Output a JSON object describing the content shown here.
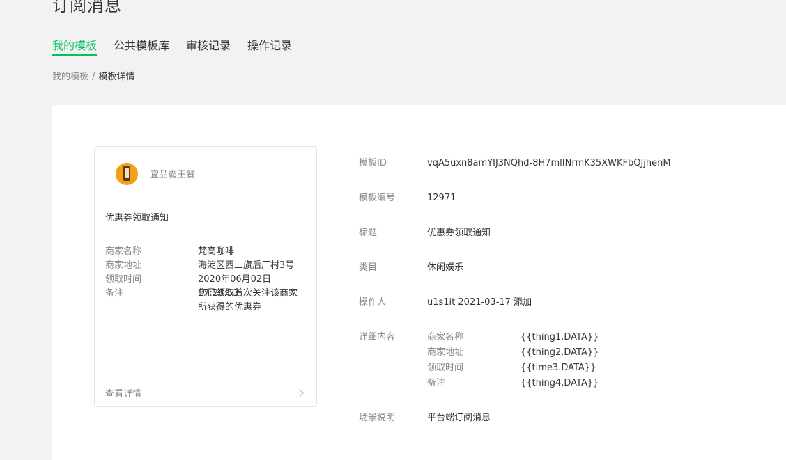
{
  "page": {
    "title": "订阅消息"
  },
  "tabs": [
    {
      "label": "我的模板",
      "active": true
    },
    {
      "label": "公共模板库",
      "active": false
    },
    {
      "label": "审核记录",
      "active": false
    },
    {
      "label": "操作记录",
      "active": false
    }
  ],
  "breadcrumb": {
    "parent": "我的模板",
    "separator": "/",
    "current": "模板详情"
  },
  "preview": {
    "avatar_icon": "phone-logo-icon",
    "shop_name": "宜品霸王餐",
    "title": "优惠券领取通知",
    "fields": [
      {
        "key": "商家名称",
        "value": "梵高咖啡"
      },
      {
        "key": "商家地址",
        "value": "海淀区西二旗后厂村3号"
      },
      {
        "key": "领取时间",
        "value": "2020年06月02日17:28:53"
      },
      {
        "key": "备注",
        "value": "您已领取首次关注该商家所获得的优惠券"
      }
    ],
    "footer_label": "查看详情",
    "footer_icon": "chevron-right-icon"
  },
  "info": {
    "template_id": {
      "label": "模板ID",
      "value": "vqA5uxn8amYIJ3NQhd-8H7mlINrmK35XWKFbQJjhenM"
    },
    "template_no": {
      "label": "模板编号",
      "value": "12971"
    },
    "title": {
      "label": "标题",
      "value": "优惠券领取通知"
    },
    "category": {
      "label": "类目",
      "value": "休闲娱乐"
    },
    "operator": {
      "label": "操作人",
      "value": "u1s1it 2021-03-17 添加"
    },
    "details": {
      "label": "详细内容",
      "items": [
        {
          "key": "商家名称",
          "value": "{{thing1.DATA}}"
        },
        {
          "key": "商家地址",
          "value": "{{thing2.DATA}}"
        },
        {
          "key": "领取时间",
          "value": "{{time3.DATA}}"
        },
        {
          "key": "备注",
          "value": "{{thing4.DATA}}"
        }
      ]
    },
    "scene": {
      "label": "场景说明",
      "value": "平台端订阅消息"
    }
  },
  "colors": {
    "accent": "#07c160",
    "muted": "#888888",
    "text": "#353535",
    "background": "#f2f2f2"
  }
}
